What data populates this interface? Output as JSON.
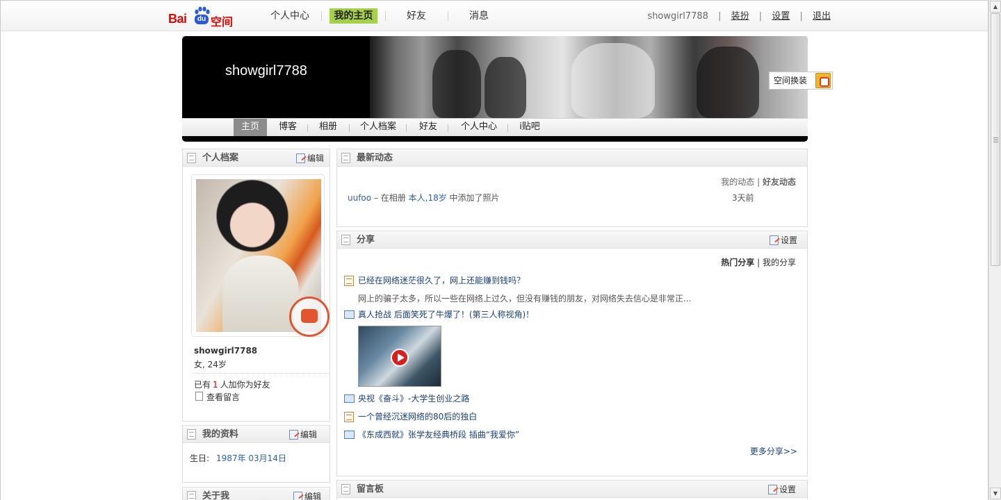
{
  "topbar": {
    "logo_text_latin": "Bai",
    "logo_text_du": "du",
    "logo_text_cn": "空间",
    "nav": [
      "个人中心",
      "我的主页",
      "好友",
      "消息"
    ],
    "active_nav": "我的主页",
    "username": "showgirl7788",
    "links": [
      "装扮",
      "设置",
      "退出"
    ],
    "separator": "|"
  },
  "banner": {
    "title": "showgirl7788",
    "tabs": [
      "主页",
      "博客",
      "相册",
      "个人档案",
      "好友",
      "个人中心",
      "i贴吧"
    ],
    "active_tab": "主页",
    "theme_button": "空间换装"
  },
  "profile_panel": {
    "title": "个人档案",
    "edit_label": "编辑",
    "name": "showgirl7788",
    "meta": "女, 24岁",
    "friend_prefix": "已有",
    "friend_count": "1",
    "friend_suffix": "人加你为好友",
    "message_link": "查看留言"
  },
  "info_panel": {
    "title": "我的资料",
    "edit_label": "编辑",
    "birthday_label": "生日:",
    "birthday_value": "1987年 03月14日"
  },
  "about_panel": {
    "title": "关于我",
    "edit_label": "编辑"
  },
  "feed_panel": {
    "title": "最新动态",
    "my_feed": "我的动态",
    "friend_feed": "好友动态",
    "separator": "|",
    "item": {
      "user": "uufoo",
      "dash": "–",
      "action_pre": "在相册",
      "album": "本人,18岁",
      "action_post": "中添加了照片",
      "time": "3天前"
    }
  },
  "share_panel": {
    "title": "分享",
    "settings_label": "设置",
    "hot_share": "热门分享",
    "my_share": "我的分享",
    "separator": "|",
    "items": [
      {
        "type": "doc",
        "title": "已经在网络迷茫很久了，网上还能赚到钱吗？"
      },
      {
        "type": "video",
        "title": "真人抢战 后面笑死了牛爆了！(第三人称视角)！"
      },
      {
        "type": "video",
        "title": "央视《奋斗》-大学生创业之路"
      },
      {
        "type": "doc",
        "title": "一个曾经沉迷网络的80后的独白"
      },
      {
        "type": "video",
        "title": "《东成西就》张学友经典桥段 插曲“我爱你”"
      }
    ],
    "desc": "网上的骗子太多，所以一些在网络上过久，但没有赚钱的朋友，对网络失去信心是非常正...",
    "more": "更多分享>>"
  },
  "guestbook_panel": {
    "title": "留言板",
    "settings_label": "设置"
  },
  "colors": {
    "brand_red": "#e10601",
    "active_nav": "#a6cf4b",
    "link_blue": "#2a5ea8"
  }
}
